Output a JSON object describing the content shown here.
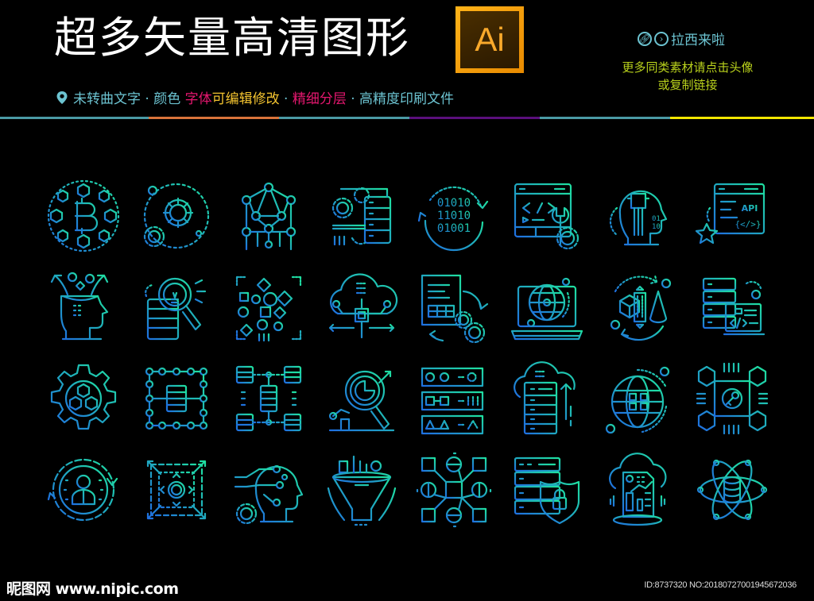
{
  "header": {
    "title": "超多矢量高清图形",
    "ai_badge": "Ai",
    "subtitle_segments": [
      {
        "text": "未转曲文字 · 颜色 ",
        "color": "#6cc3d1"
      },
      {
        "text": "字体",
        "color": "#e5176f"
      },
      {
        "text": "可编辑修改",
        "color": "#f4c430"
      },
      {
        "text": " · ",
        "color": "#6cc3d1"
      },
      {
        "text": "精细分层",
        "color": "#e5176f"
      },
      {
        "text": " · 高精度印刷文件",
        "color": "#6cc3d1"
      }
    ],
    "author_name": "拉西来啦",
    "note_line1": "更多同类素材请点击头像",
    "note_line2": "或复制链接"
  },
  "divider_colors": [
    "#4a9aa5",
    "#d9733a",
    "#4a9aa5",
    "#5a0f7c",
    "#4a9aa5",
    "#f2e600"
  ],
  "icon_gradient": {
    "start": "#1f6fe0",
    "end": "#1fe0a0"
  },
  "icons": [
    {
      "name": "bitcoin-blockchain-icon"
    },
    {
      "name": "gear-settings-cycle-icon"
    },
    {
      "name": "neural-network-icon"
    },
    {
      "name": "server-gears-laptop-icon"
    },
    {
      "name": "binary-data-cycle-icon"
    },
    {
      "name": "code-window-wrench-icon"
    },
    {
      "name": "ai-head-chip-icon"
    },
    {
      "name": "api-window-star-icon"
    },
    {
      "name": "head-ideas-icon"
    },
    {
      "name": "server-search-idea-icon"
    },
    {
      "name": "scattered-shapes-data-icon"
    },
    {
      "name": "cloud-chip-network-icon"
    },
    {
      "name": "document-table-gears-icon"
    },
    {
      "name": "laptop-globe-icon"
    },
    {
      "name": "3d-shapes-cycle-icon"
    },
    {
      "name": "server-code-monitor-icon"
    },
    {
      "name": "gear-cubes-icon"
    },
    {
      "name": "server-node-grid-icon"
    },
    {
      "name": "server-database-connection-icon"
    },
    {
      "name": "magnifier-chart-analytics-icon"
    },
    {
      "name": "data-structures-panel-icon"
    },
    {
      "name": "cloud-server-upload-icon"
    },
    {
      "name": "globe-network-icon"
    },
    {
      "name": "blockchain-key-icon"
    },
    {
      "name": "user-cycle-icon"
    },
    {
      "name": "expand-center-icon"
    },
    {
      "name": "ai-head-circuit-gear-icon"
    },
    {
      "name": "data-funnel-chart-icon"
    },
    {
      "name": "node-structure-icon"
    },
    {
      "name": "server-shield-lock-icon"
    },
    {
      "name": "cloud-report-hologram-icon"
    },
    {
      "name": "atom-database-icon"
    }
  ],
  "footer": {
    "logo_text": "昵图网 www.nipic.com",
    "id_text": "ID:8737320 NO:20180727001945672036"
  }
}
